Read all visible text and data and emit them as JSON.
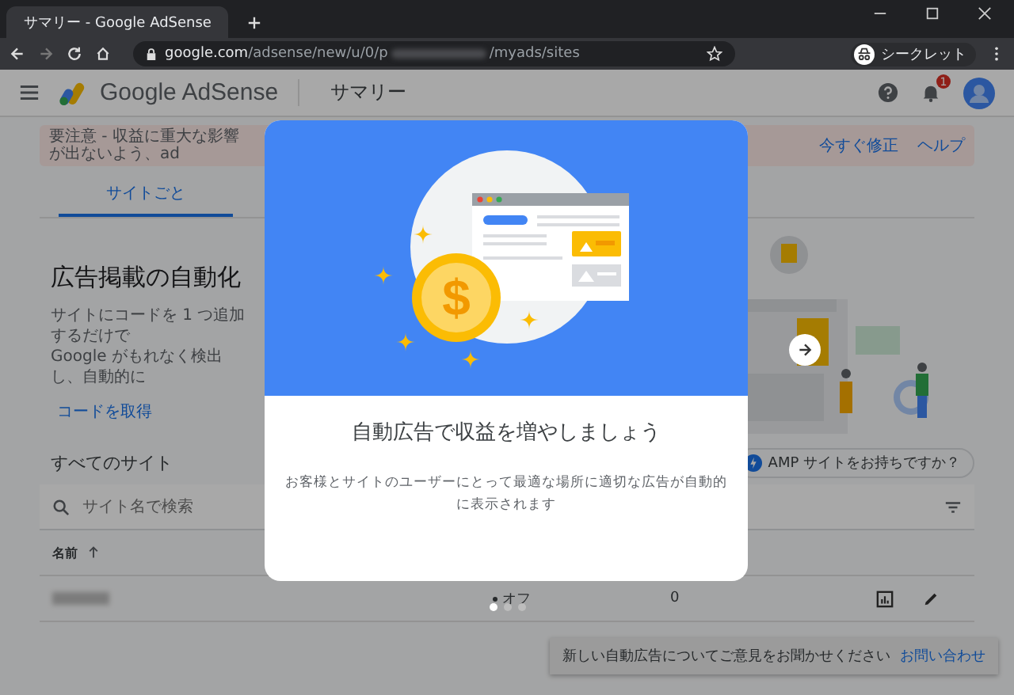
{
  "browser": {
    "tab_title": "サマリー - Google AdSense",
    "url_host": "google.com",
    "url_path_start": "/adsense/new/u/0/p",
    "url_path_end": "/myads/sites",
    "profile": "シークレット"
  },
  "header": {
    "product": "Google AdSense",
    "page_title": "サマリー",
    "notification_count": "1"
  },
  "banner": {
    "text": "要注意 - 収益に重大な影響が出ないよう、ad",
    "actions": [
      "今すぐ修正",
      "ヘルプ"
    ]
  },
  "tabs": [
    {
      "label": "サイトごと",
      "selected": true
    }
  ],
  "hero": {
    "title": "広告掲載の自動化",
    "description_lines": [
      "サイトにコードを 1 つ追加するだけで",
      "Google がもれなく検出し、自動的に"
    ],
    "link": "コードを取得"
  },
  "sites": {
    "title": "すべてのサイト",
    "amp_chip": "AMP サイトをお持ちですか？",
    "search_placeholder": "サイト名で検索",
    "columns": [
      {
        "label": "名前",
        "sorted_ascending": true
      }
    ],
    "rows": [
      {
        "status": "オフ",
        "count": "0"
      }
    ]
  },
  "feedback": {
    "text": "新しい自動広告についてご意見をお聞かせください",
    "link": "お問い合わせ"
  },
  "modal": {
    "coin_symbol": "$",
    "title": "自動広告で収益を増やしましょう",
    "description": "お客様とサイトのユーザーにとって最適な場所に適切な広告が自動的に表示されます",
    "pages": [
      {
        "selected": true
      },
      {
        "selected": false
      },
      {
        "selected": false
      }
    ]
  }
}
